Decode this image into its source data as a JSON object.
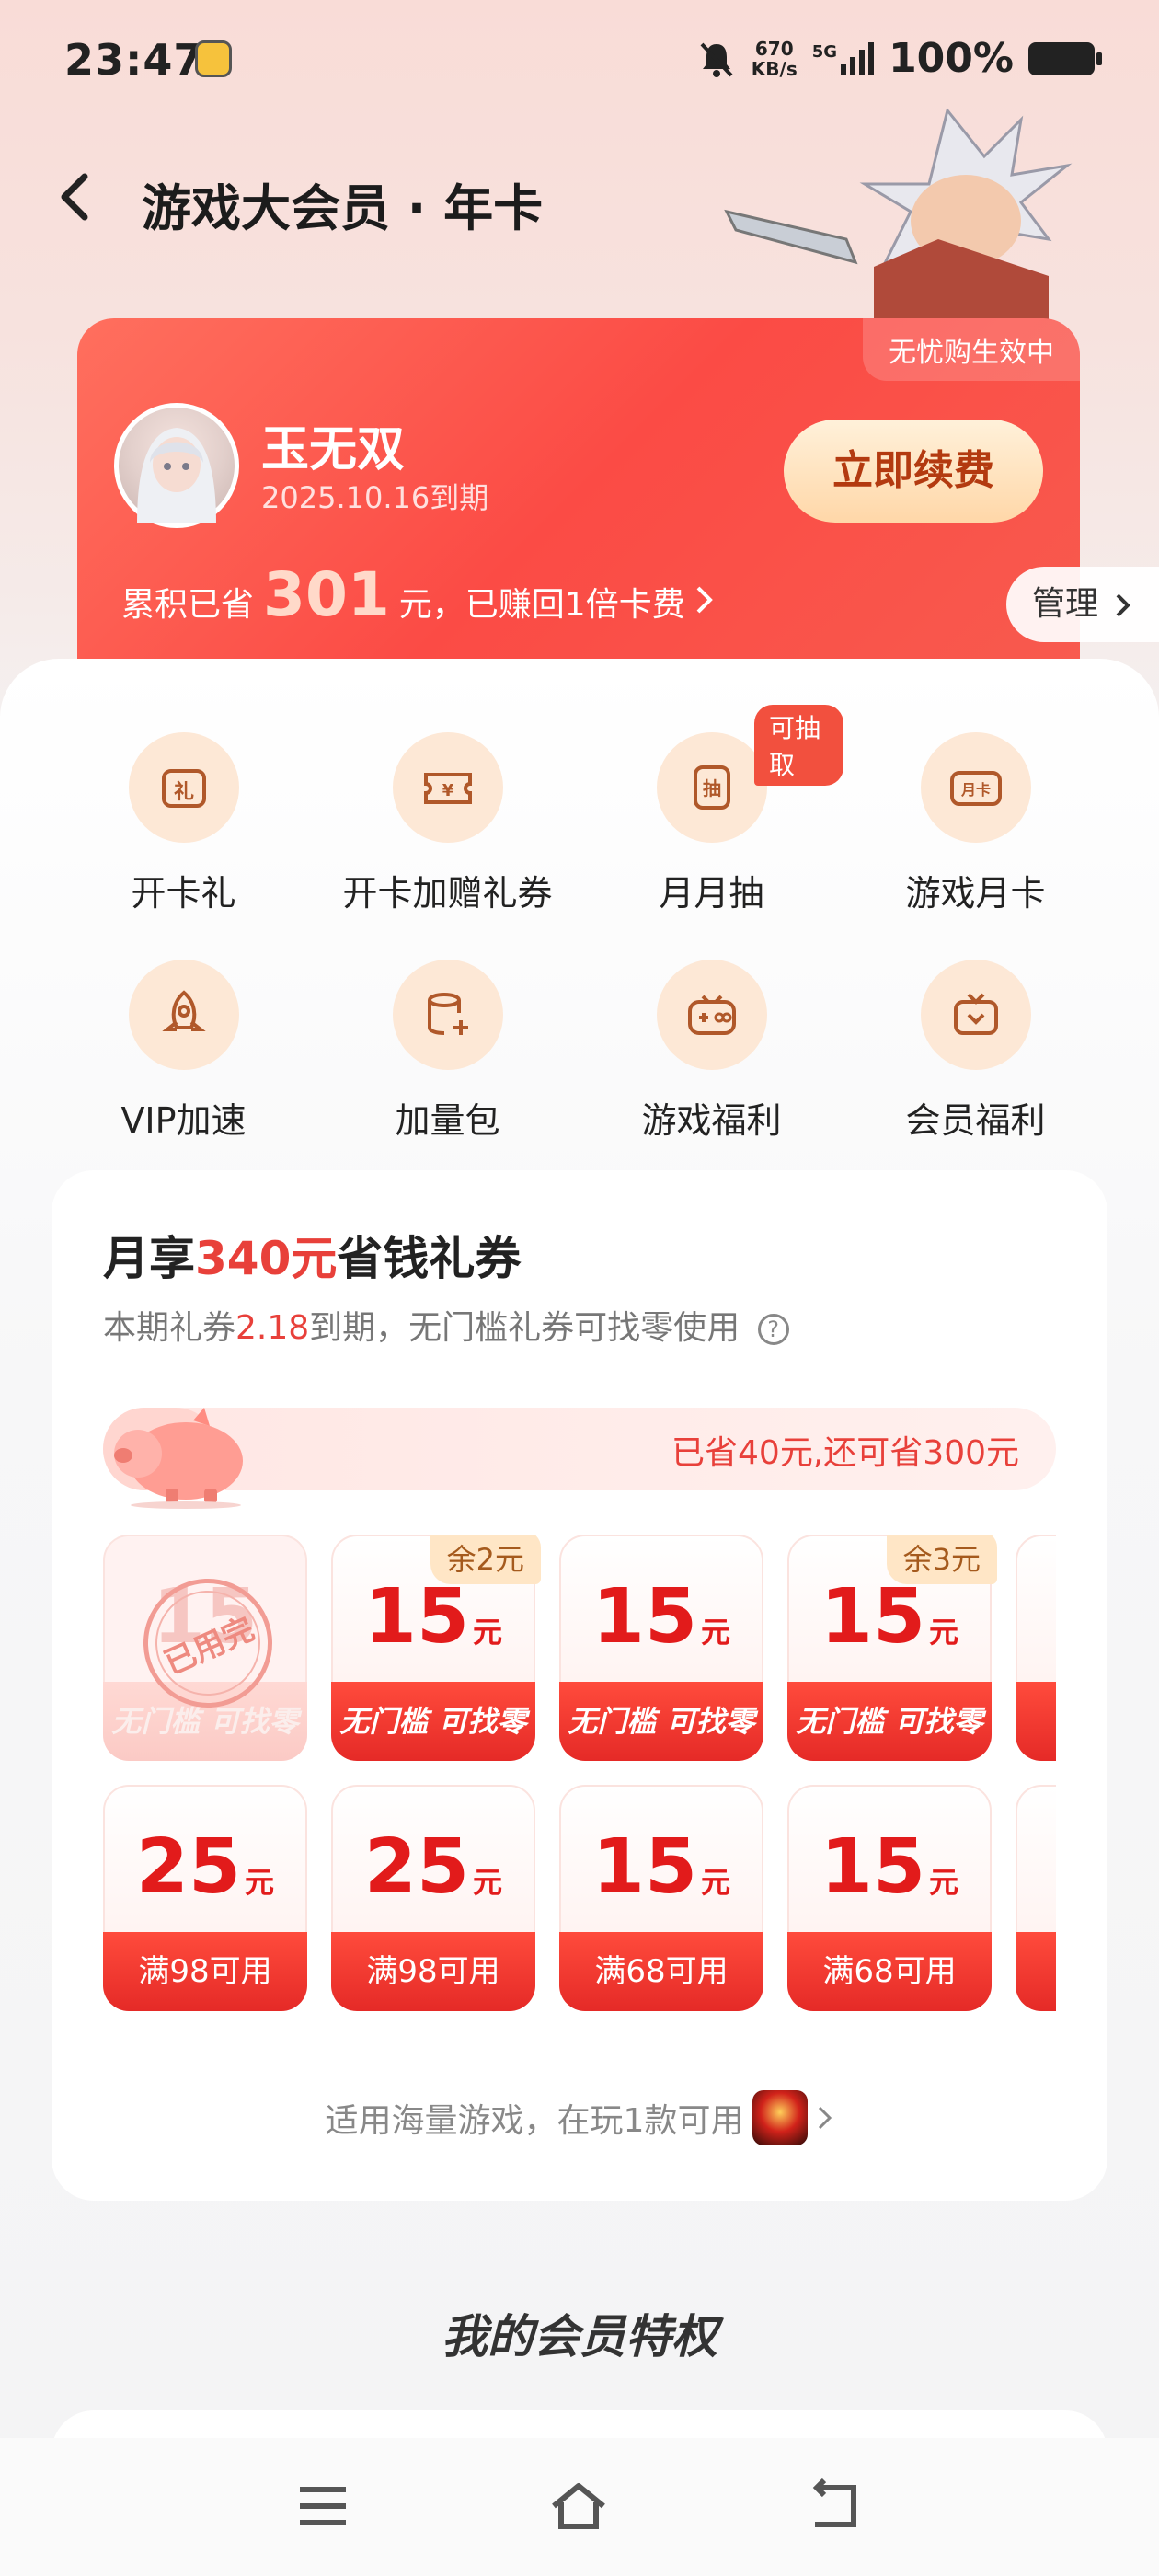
{
  "status": {
    "time": "23:47",
    "speed_value": "670",
    "speed_unit": "KB/s",
    "network": "5G",
    "battery": "100%"
  },
  "nav": {
    "title": "游戏大会员 · 年卡"
  },
  "card": {
    "badge": "无忧购生效中",
    "name": "玉无双",
    "expiry": "2025.10.16到期",
    "renew_label": "立即续费",
    "savings_prefix": "累积已省",
    "savings_amount": "301",
    "savings_suffix": "元，已赚回1倍卡费",
    "manage_label": "管理"
  },
  "features": [
    {
      "label": "开卡礼",
      "icon": "gift-icon"
    },
    {
      "label": "开卡加赠礼券",
      "icon": "ticket-icon"
    },
    {
      "label": "月月抽",
      "icon": "lottery-icon",
      "tag": "可抽取"
    },
    {
      "label": "游戏月卡",
      "icon": "monthly-card-icon"
    },
    {
      "label": "VIP加速",
      "icon": "rocket-icon"
    },
    {
      "label": "加量包",
      "icon": "data-pack-icon"
    },
    {
      "label": "游戏福利",
      "icon": "gamepad-icon"
    },
    {
      "label": "会员福利",
      "icon": "member-gift-icon"
    }
  ],
  "coupons": {
    "title_prefix": "月享",
    "title_amount": "340元",
    "title_suffix": "省钱礼券",
    "sub_prefix": "本期礼券",
    "sub_date": "2.18",
    "sub_suffix": "到期，无门槛礼券可找零使用",
    "progress_text": "已省40元,还可省300元",
    "progress_saved_fraction": 0.12,
    "row1": [
      {
        "value": "15",
        "unit": "元",
        "caption": "无门槛 可找零",
        "used": true,
        "stamp": "已用完"
      },
      {
        "value": "15",
        "unit": "元",
        "caption": "无门槛 可找零",
        "remaining": "余2元"
      },
      {
        "value": "15",
        "unit": "元",
        "caption": "无门槛 可找零"
      },
      {
        "value": "15",
        "unit": "元",
        "caption": "无门槛 可找零",
        "remaining": "余3元"
      }
    ],
    "row2": [
      {
        "value": "25",
        "unit": "元",
        "caption": "满98可用"
      },
      {
        "value": "25",
        "unit": "元",
        "caption": "满98可用"
      },
      {
        "value": "15",
        "unit": "元",
        "caption": "满68可用"
      },
      {
        "value": "15",
        "unit": "元",
        "caption": "满68可用"
      }
    ],
    "applies_text": "适用海量游戏，在玩1款可用"
  },
  "privileges": {
    "title": "我的会员特权"
  },
  "colors": {
    "accent": "#e8403a",
    "card_red": "#fb4b45",
    "icon_bg": "#fde8d6",
    "renew_text": "#b33a10"
  }
}
